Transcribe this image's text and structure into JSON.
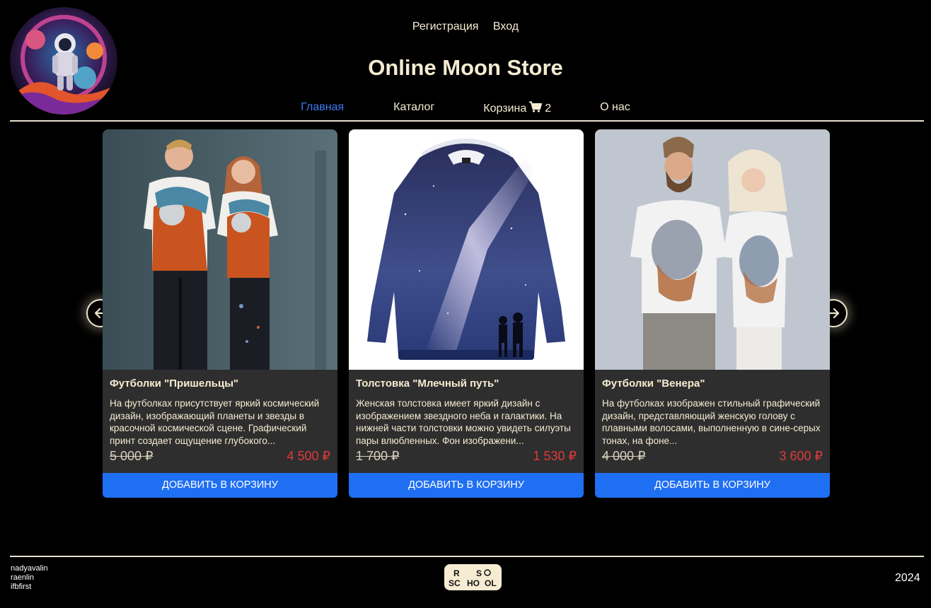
{
  "header": {
    "auth_links": [
      "Регистрация",
      "Вход"
    ],
    "title": "Online Moon Store",
    "nav": {
      "home": "Главная",
      "catalog": "Каталог",
      "cart": "Корзина",
      "cart_count": "2",
      "about": "О нас"
    }
  },
  "products": [
    {
      "title": "Футболки \"Пришельцы\"",
      "description": "На футболках присутствует яркий космический дизайн, изображающий планеты и звезды в красочной космической сцене. Графический принт создает ощущение глубокого...",
      "old_price": "5 000 ₽",
      "new_price": "4 500 ₽",
      "button": "ДОБАВИТЬ В КОРЗИНУ"
    },
    {
      "title": "Толстовка \"Млечный путь\"",
      "description": "Женская толстовка имеет яркий дизайн с изображением звездного неба и галактики. На нижней части толстовки можно увидеть силуэты пары влюбленных. Фон изображени...",
      "old_price": "1 700 ₽",
      "new_price": "1 530 ₽",
      "button": "ДОБАВИТЬ В КОРЗИНУ"
    },
    {
      "title": "Футболки \"Венера\"",
      "description": "На футболках изображен стильный графический дизайн, представляющий женскую голову с плавными волосами, выполненную в сине-серых тонах, на фоне...",
      "old_price": "4 000 ₽",
      "new_price": "3 600 ₽",
      "button": "ДОБАВИТЬ В КОРЗИНУ"
    }
  ],
  "footer": {
    "authors": [
      "nadyavalin",
      "raenlin",
      "ifbfirst"
    ],
    "school_logo_text": [
      "R",
      "S",
      "SC",
      "HO",
      "OL"
    ],
    "year": "2024"
  },
  "icons": {
    "logo": "astronaut-logo-icon",
    "cart": "cart-icon",
    "prev": "arrow-left-icon",
    "next": "arrow-right-icon"
  },
  "colors": {
    "background": "#000000",
    "text": "#f5ecd2",
    "nav_active": "#3d7bf3",
    "button": "#1f6ff2",
    "new_price": "#e03a3a",
    "card_body": "#2e2e2e"
  }
}
